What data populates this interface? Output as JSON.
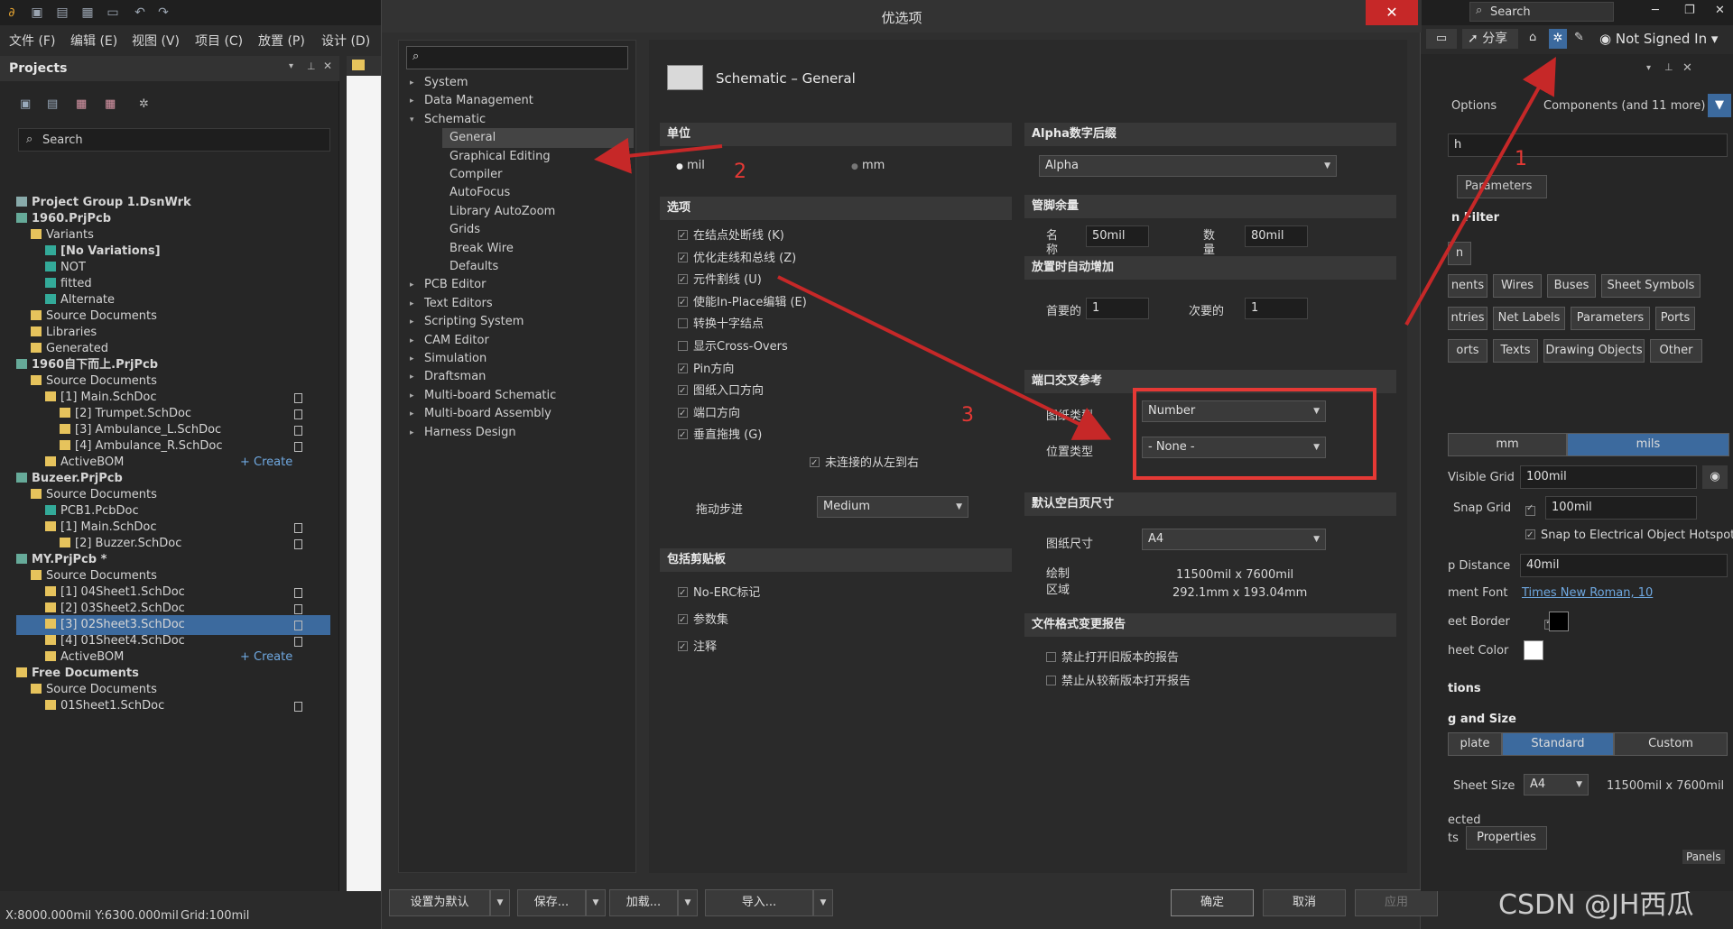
{
  "app": {
    "menus": [
      "文件 (F)",
      "编辑 (E)",
      "视图 (V)",
      "项目 (C)",
      "放置 (P)",
      "设计 (D)"
    ],
    "search_placeholder": "Search",
    "share_label": "分享",
    "user_label": "Not Signed In"
  },
  "projects": {
    "title": "Projects",
    "search_placeholder": "Search",
    "tree": [
      {
        "label": "Project Group 1.DsnWrk",
        "bold": true
      },
      {
        "label": "1960.PrjPcb",
        "bold": true
      },
      {
        "label": "Variants"
      },
      {
        "label": "[No Variations]",
        "bold": true
      },
      {
        "label": "NOT"
      },
      {
        "label": "fitted"
      },
      {
        "label": "Alternate"
      },
      {
        "label": "Source Documents"
      },
      {
        "label": "Libraries"
      },
      {
        "label": "Generated"
      },
      {
        "label": "1960自下而上.PrjPcb",
        "bold": true
      },
      {
        "label": "Source Documents"
      },
      {
        "label": "[1] Main.SchDoc"
      },
      {
        "label": "[2] Trumpet.SchDoc"
      },
      {
        "label": "[3] Ambulance_L.SchDoc"
      },
      {
        "label": "[4] Ambulance_R.SchDoc"
      },
      {
        "label": "ActiveBOM",
        "create": "+ Create"
      },
      {
        "label": "Buzeer.PrjPcb",
        "bold": true
      },
      {
        "label": "Source Documents"
      },
      {
        "label": "PCB1.PcbDoc"
      },
      {
        "label": "[1] Main.SchDoc"
      },
      {
        "label": "[2] Buzzer.SchDoc"
      },
      {
        "label": "MY.PrjPcb *",
        "bold": true
      },
      {
        "label": "Source Documents"
      },
      {
        "label": "[1] 04Sheet1.SchDoc"
      },
      {
        "label": "[2] 03Sheet2.SchDoc"
      },
      {
        "label": "[3] 02Sheet3.SchDoc",
        "selected": true
      },
      {
        "label": "[4] 01Sheet4.SchDoc"
      },
      {
        "label": "ActiveBOM",
        "create": "+ Create"
      },
      {
        "label": "Free Documents",
        "bold": true
      },
      {
        "label": "Source Documents"
      },
      {
        "label": "01Sheet1.SchDoc"
      }
    ]
  },
  "status": {
    "coords": "X:8000.000mil Y:6300.000mil",
    "grid": "Grid:100mil"
  },
  "dialog": {
    "title": "优选项",
    "nav": [
      {
        "label": "System",
        "top": true
      },
      {
        "label": "Data Management",
        "top": true
      },
      {
        "label": "Schematic",
        "top": true,
        "open": true
      },
      {
        "label": "General",
        "sel": true
      },
      {
        "label": "Graphical Editing"
      },
      {
        "label": "Compiler"
      },
      {
        "label": "AutoFocus"
      },
      {
        "label": "Library AutoZoom"
      },
      {
        "label": "Grids"
      },
      {
        "label": "Break Wire"
      },
      {
        "label": "Defaults"
      },
      {
        "label": "PCB Editor",
        "top": true
      },
      {
        "label": "Text Editors",
        "top": true
      },
      {
        "label": "Scripting System",
        "top": true
      },
      {
        "label": "CAM Editor",
        "top": true
      },
      {
        "label": "Simulation",
        "top": true
      },
      {
        "label": "Draftsman",
        "top": true
      },
      {
        "label": "Multi-board Schematic",
        "top": true
      },
      {
        "label": "Multi-board Assembly",
        "top": true
      },
      {
        "label": "Harness Design",
        "top": true
      }
    ],
    "page_title": "Schematic – General",
    "units": {
      "header": "单位",
      "mil": "mil",
      "mm": "mm"
    },
    "options": {
      "header": "选项",
      "items": [
        {
          "label": "在结点处断线 (K)",
          "on": true
        },
        {
          "label": "优化走线和总线 (Z)",
          "on": true
        },
        {
          "label": "元件割线 (U)",
          "on": true
        },
        {
          "label": "使能In-Place编辑 (E)",
          "on": true
        },
        {
          "label": "转换十字结点",
          "on": false
        },
        {
          "label": "显示Cross-Overs",
          "on": false
        },
        {
          "label": "Pin方向",
          "on": true
        },
        {
          "label": "图纸入口方向",
          "on": true
        },
        {
          "label": "端口方向",
          "on": true
        },
        {
          "label": "垂直拖拽 (G)",
          "on": true
        }
      ],
      "unconnected": "未连接的从左到右",
      "drag_step_label": "拖动步进",
      "drag_step_value": "Medium"
    },
    "clipboard": {
      "header": "包括剪贴板",
      "items": [
        "No-ERC标记",
        "参数集",
        "注释"
      ]
    },
    "alpha": {
      "header": "Alpha数字后缀",
      "value": "Alpha"
    },
    "pin_margin": {
      "header": "管脚余量",
      "name_label": "名称",
      "name_value": "50mil",
      "num_label": "数量",
      "num_value": "80mil"
    },
    "auto_inc": {
      "header": "放置时自动增加",
      "primary_label": "首要的",
      "primary_value": "1",
      "secondary_label": "次要的",
      "secondary_value": "1"
    },
    "port_ref": {
      "header": "端口交叉参考",
      "sheet_type_label": "图纸类型",
      "sheet_type_value": "Number",
      "pos_type_label": "位置类型",
      "pos_type_value": "- None -"
    },
    "blank_sheet": {
      "header": "默认空白页尺寸",
      "size_label": "图纸尺寸",
      "size_value": "A4",
      "area_label": "绘制区域",
      "area_mil": "11500mil x 7600mil",
      "area_mm": "292.1mm x 193.04mm"
    },
    "file_report": {
      "header": "文件格式变更报告",
      "items": [
        "禁止打开旧版本的报告",
        "禁止从较新版本打开报告"
      ]
    },
    "buttons": {
      "set_default": "设置为默认",
      "save": "保存...",
      "load": "加载...",
      "import": "导入...",
      "ok": "确定",
      "cancel": "取消",
      "apply": "应用"
    }
  },
  "right": {
    "options": "Options",
    "components": "Components (and 11 more)",
    "h_text": "h",
    "parameters_tab": "Parameters",
    "filter": "n Filter",
    "row1": [
      "Wires",
      "Buses",
      "Sheet Symbols"
    ],
    "row2": [
      "Net Labels",
      "Parameters",
      "Ports"
    ],
    "row3": [
      "Texts",
      "Drawing Objects",
      "Other"
    ],
    "partial": [
      "n",
      "nents",
      "ntries",
      "orts"
    ],
    "mm": "mm",
    "mils": "mils",
    "visible_grid_label": "Visible Grid",
    "visible_grid_value": "100mil",
    "snap_grid_label": "Snap Grid",
    "snap_grid_value": "100mil",
    "snap_hotspot": "Snap to Electrical Object Hotspots",
    "distance_label": "p Distance",
    "distance_value": "40mil",
    "font_label": "ment Font",
    "font_value": "Times New Roman, 10",
    "border_label": "eet Border",
    "sheet_color_label": "heet Color",
    "options2": "tions",
    "size_header": "g and Size",
    "template": "plate",
    "standard": "Standard",
    "custom": "Custom",
    "sheet_size_label": "Sheet Size",
    "sheet_size_value": "A4",
    "sheet_size_dims": "11500mil x 7600mil",
    "selected": "ected",
    "bottom_tab": "Properties",
    "bottom_left": "ts",
    "panels": "Panels"
  },
  "annotations": {
    "n1": "1",
    "n2": "2",
    "n3": "3"
  },
  "watermark": "CSDN @JH西瓜"
}
